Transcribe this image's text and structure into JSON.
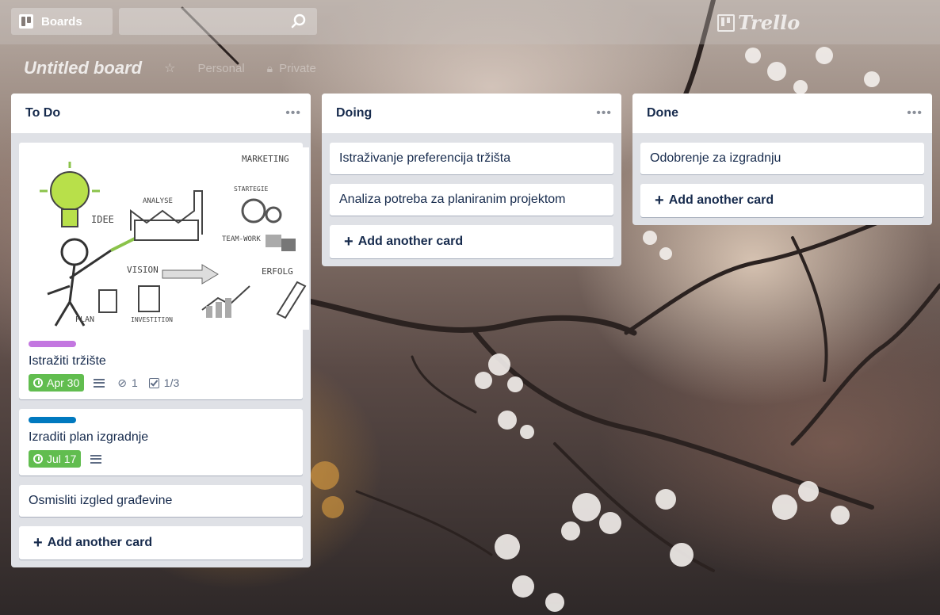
{
  "header": {
    "boards_label": "Boards",
    "logo_text": "Trello"
  },
  "board": {
    "title": "Untitled board",
    "team_label": "Personal",
    "visibility_label": "Private"
  },
  "lists": [
    {
      "title": "To Do",
      "cards": [
        {
          "has_cover": true,
          "cover_words": [
            "MARKETING",
            "ANALYSE",
            "STARTEGIE",
            "IDEE",
            "TEAM-WORK",
            "VISION",
            "ERFOLG",
            "PLAN",
            "INVESTITION"
          ],
          "label_color": "#c377e0",
          "title": "Istražiti tržište",
          "due": "Apr 30",
          "attachments": "1",
          "checklist": "1/3"
        },
        {
          "label_color": "#0079bf",
          "title": "Izraditi plan izgradnje",
          "due": "Jul 17"
        },
        {
          "title": "Osmisliti izgled građevine"
        }
      ],
      "add_label": "Add another card"
    },
    {
      "title": "Doing",
      "cards": [
        {
          "title": "Istraživanje preferencija tržišta"
        },
        {
          "title": "Analiza potreba za planiranim projektom"
        }
      ],
      "add_label": "Add another card"
    },
    {
      "title": "Done",
      "cards": [
        {
          "title": "Odobrenje za izgradnju"
        }
      ],
      "add_label": "Add another card"
    }
  ],
  "colors": {
    "due_green": "#61bd4f",
    "list_bg": "#dfe1e6",
    "text": "#172b4d"
  },
  "icons": {
    "board": "board-icon",
    "search": "search-icon",
    "star": "star-icon",
    "lock": "lock-icon",
    "more": "more-icon",
    "clock": "clock-icon",
    "description": "description-icon",
    "attachment": "paperclip-icon",
    "checklist": "checklist-icon",
    "plus": "plus-icon"
  }
}
